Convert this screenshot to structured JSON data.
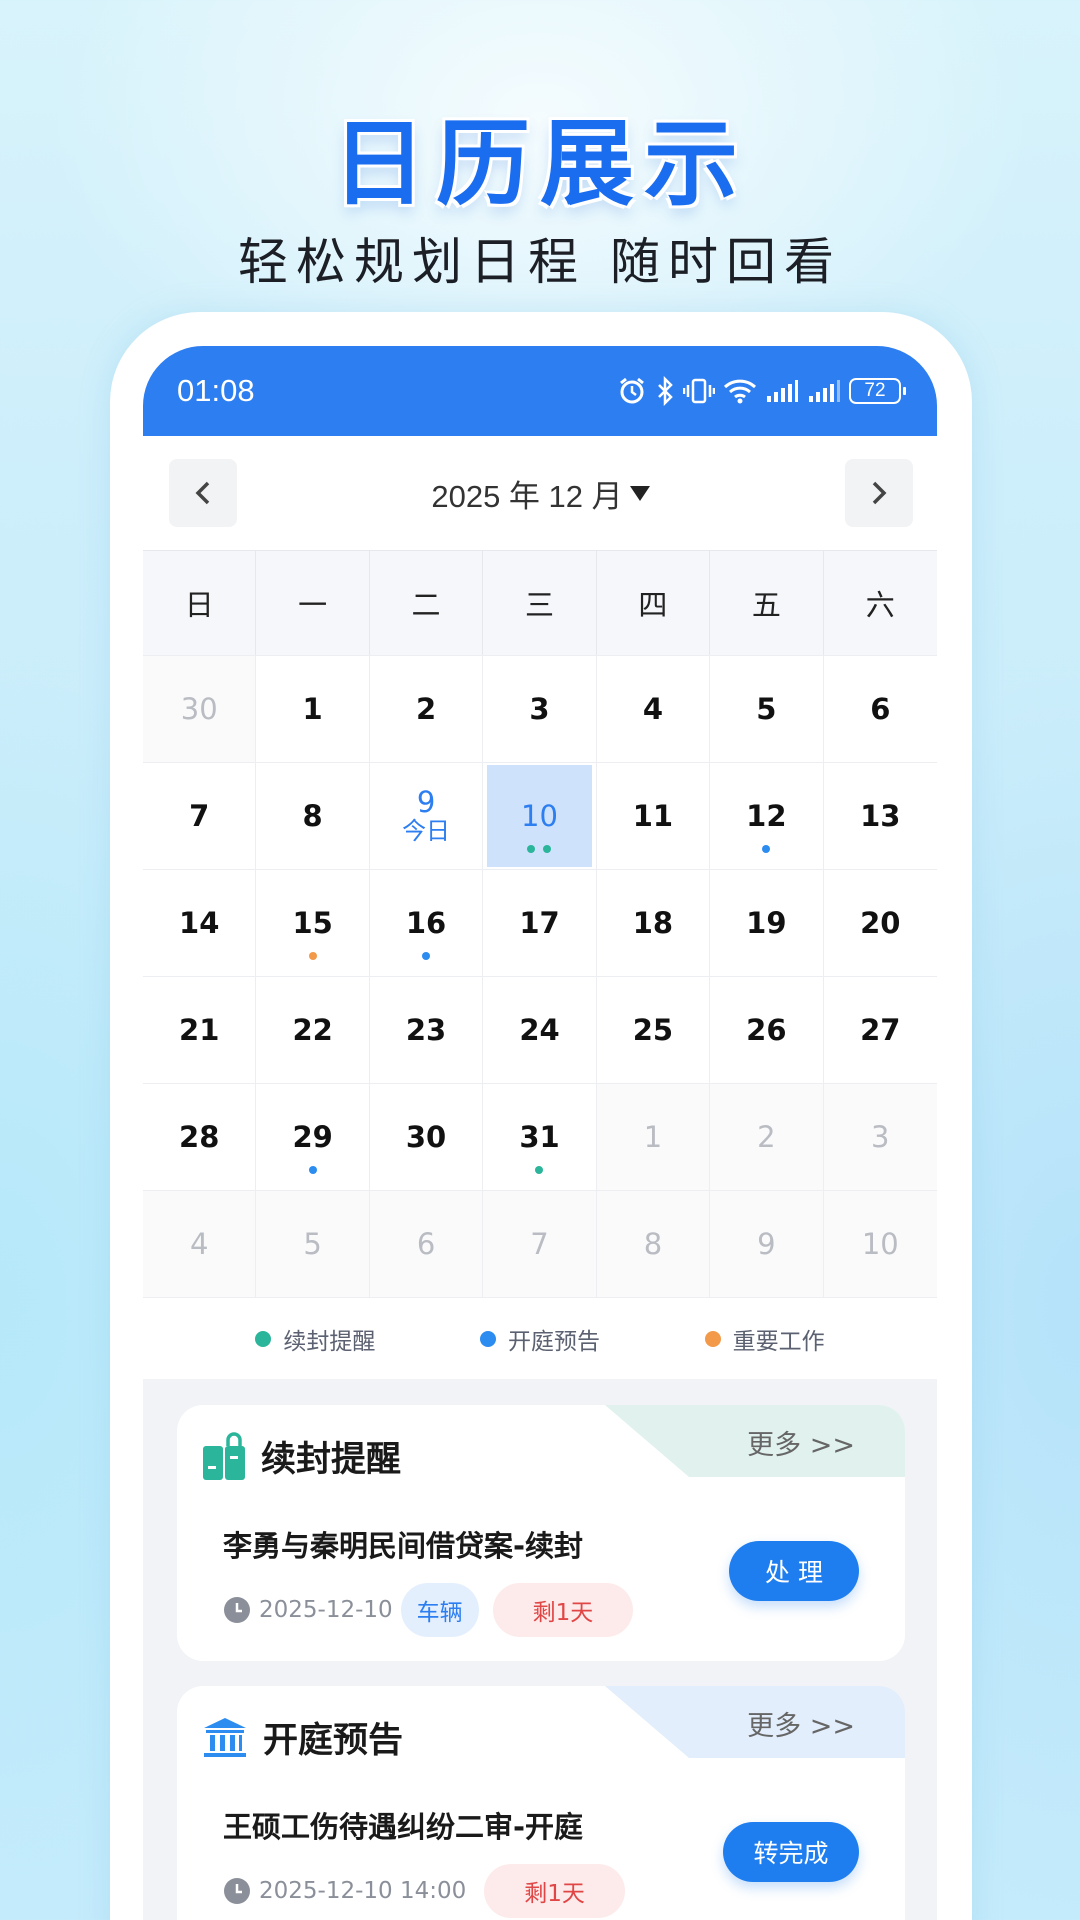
{
  "hero": {
    "title": "日历展示",
    "subtitle": "轻松规划日程  随时回看"
  },
  "status_bar": {
    "time": "01:08",
    "battery": "72"
  },
  "calendar": {
    "month_label": "2025 年 12 月",
    "weekdays": [
      "日",
      "一",
      "二",
      "三",
      "四",
      "五",
      "六"
    ],
    "days": [
      {
        "n": "30",
        "other": true
      },
      {
        "n": "1"
      },
      {
        "n": "2"
      },
      {
        "n": "3"
      },
      {
        "n": "4"
      },
      {
        "n": "5"
      },
      {
        "n": "6"
      },
      {
        "n": "7"
      },
      {
        "n": "8"
      },
      {
        "n": "9",
        "today": true,
        "sub": "今日"
      },
      {
        "n": "10",
        "selected": true,
        "dots": [
          "#2bb59a",
          "#2bb59a"
        ]
      },
      {
        "n": "11"
      },
      {
        "n": "12",
        "dots": [
          "#2d8cf0"
        ]
      },
      {
        "n": "13"
      },
      {
        "n": "14"
      },
      {
        "n": "15",
        "dots": [
          "#f29a4a"
        ]
      },
      {
        "n": "16",
        "dots": [
          "#2d8cf0"
        ]
      },
      {
        "n": "17"
      },
      {
        "n": "18"
      },
      {
        "n": "19"
      },
      {
        "n": "20"
      },
      {
        "n": "21"
      },
      {
        "n": "22"
      },
      {
        "n": "23"
      },
      {
        "n": "24"
      },
      {
        "n": "25"
      },
      {
        "n": "26"
      },
      {
        "n": "27"
      },
      {
        "n": "28"
      },
      {
        "n": "29",
        "dots": [
          "#2d8cf0"
        ]
      },
      {
        "n": "30"
      },
      {
        "n": "31",
        "dots": [
          "#2bb59a"
        ]
      },
      {
        "n": "1",
        "other": true
      },
      {
        "n": "2",
        "other": true
      },
      {
        "n": "3",
        "other": true
      },
      {
        "n": "4",
        "other": true
      },
      {
        "n": "5",
        "other": true
      },
      {
        "n": "6",
        "other": true
      },
      {
        "n": "7",
        "other": true
      },
      {
        "n": "8",
        "other": true
      },
      {
        "n": "9",
        "other": true
      },
      {
        "n": "10",
        "other": true
      }
    ]
  },
  "legend": [
    {
      "label": "续封提醒",
      "color": "#2bb59a"
    },
    {
      "label": "开庭预告",
      "color": "#2d8cf0"
    },
    {
      "label": "重要工作",
      "color": "#f29a4a"
    }
  ],
  "cards": {
    "seal": {
      "title": "续封提醒",
      "more": "更多 >>",
      "item_title": "李勇与秦明民间借贷案-续封",
      "date": "2025-12-10",
      "tag": "车辆",
      "remain": "剩1天",
      "action": "处  理",
      "tab_color": "#e1f2ee"
    },
    "court": {
      "title": "开庭预告",
      "more": "更多 >>",
      "item_title": "王硕工伤待遇纠纷二审-开庭",
      "date": "2025-12-10 14:00",
      "remain": "剩1天",
      "action": "转完成",
      "tab_color": "#e2eefb"
    }
  },
  "colors": {
    "primary": "#2d7ef0",
    "teal": "#2bb59a",
    "orange": "#f29a4a",
    "red": "#e04646"
  }
}
